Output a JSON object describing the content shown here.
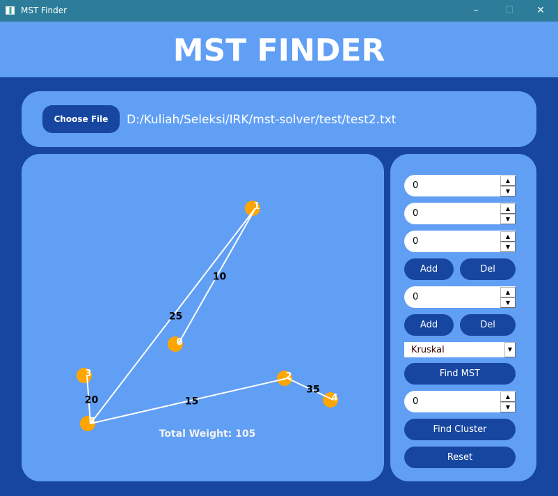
{
  "window": {
    "title": "MST Finder",
    "minimize": "–",
    "maximize": "☐",
    "close": "✕"
  },
  "header": {
    "title": "MST FINDER"
  },
  "file": {
    "button": "Choose File",
    "path": "D:/Kuliah/Seleksi/IRK/mst-solver/test/test2.txt"
  },
  "graph": {
    "nodes": [
      "0",
      "1",
      "2",
      "3",
      "4",
      "5"
    ],
    "edges": [
      {
        "from": "1",
        "to": "0",
        "weight": "10"
      },
      {
        "from": "1",
        "to": "5",
        "weight": "25"
      },
      {
        "from": "3",
        "to": "5",
        "weight": "20"
      },
      {
        "from": "5",
        "to": "2",
        "weight": "15"
      },
      {
        "from": "2",
        "to": "4",
        "weight": "35"
      }
    ],
    "total": "Total Weight: 105",
    "colors": {
      "node": "#ffa500",
      "edge": "#ffffff",
      "panel": "#619ff5"
    }
  },
  "controls": {
    "spin1": "0",
    "spin2": "0",
    "spin3": "0",
    "add1": "Add",
    "del1": "Del",
    "spin4": "0",
    "add2": "Add",
    "del2": "Del",
    "algorithm": "Kruskal",
    "find_mst": "Find MST",
    "spin5": "0",
    "find_cluster": "Find Cluster",
    "reset": "Reset"
  }
}
